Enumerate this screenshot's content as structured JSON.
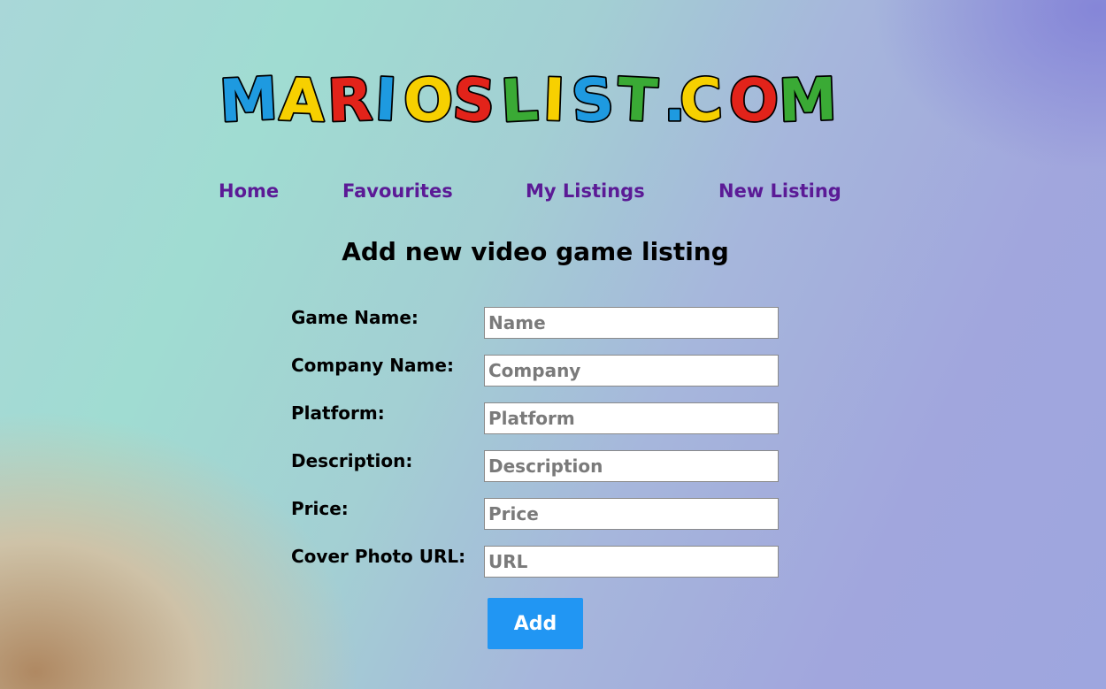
{
  "logo": {
    "letters": [
      "M",
      "A",
      "R",
      "I",
      "O",
      "S",
      "L",
      "I",
      "S",
      "T",
      ".",
      "C",
      "O",
      "M"
    ],
    "colors": {
      "blue": "#1e9ae0",
      "yellow": "#f7d000",
      "red": "#e2231a",
      "green": "#3aaa35",
      "outline": "#000000"
    }
  },
  "nav": {
    "items": [
      {
        "label": "Home"
      },
      {
        "label": "Favourites"
      },
      {
        "label": "My Listings"
      },
      {
        "label": "New Listing"
      }
    ],
    "color": "#5b1a96"
  },
  "page": {
    "title": "Add new video game listing"
  },
  "form": {
    "fields": [
      {
        "label": "Game Name:",
        "placeholder": "Name",
        "value": ""
      },
      {
        "label": "Company Name:",
        "placeholder": "Company",
        "value": ""
      },
      {
        "label": "Platform:",
        "placeholder": "Platform",
        "value": ""
      },
      {
        "label": "Description:",
        "placeholder": "Description",
        "value": ""
      },
      {
        "label": "Price:",
        "placeholder": "Price",
        "value": ""
      },
      {
        "label": "Cover Photo URL:",
        "placeholder": "URL",
        "value": ""
      }
    ],
    "submit_label": "Add",
    "submit_color": "#2196f3"
  }
}
